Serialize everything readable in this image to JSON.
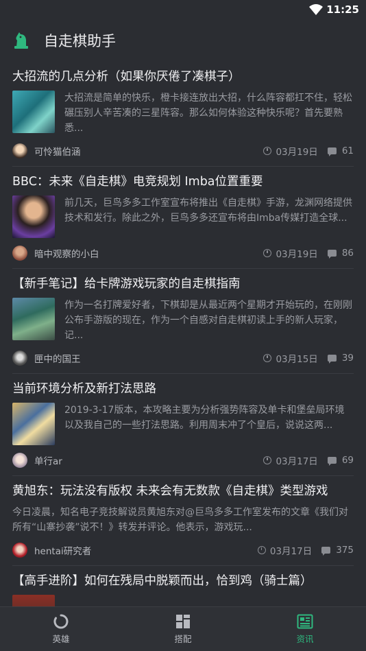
{
  "status": {
    "time": "11:25"
  },
  "app": {
    "title": "自走棋助手"
  },
  "articles": [
    {
      "title": "大招流的几点分析（如果你厌倦了凑棋子）",
      "summary": "大招流是简单的快乐，橙卡接连放出大招，什么阵容都扛不住，轻松碾压别人辛苦凑的三星阵容。那么如何体验这种快乐呢？首先要熟悉...",
      "author": "可怜猫伯涵",
      "date": "03月19日",
      "comments": "61"
    },
    {
      "title": "BBC：未来《自走棋》电竞规划 Imba位置重要",
      "summary": "前几天，巨鸟多多工作室宣布将推出《自走棋》手游，龙渊网络提供技术和发行。除此之外，巨鸟多多还宣布将由Imba传媒打造全球...",
      "author": "暗中观察的小白",
      "date": "03月19日",
      "comments": "86"
    },
    {
      "title": "【新手笔记】给卡牌游戏玩家的自走棋指南",
      "summary": "作为一名打牌爱好者，下棋却是从最近两个星期才开始玩的，在刚刚公布手游版的现在，作为一个自感对自走棋初读上手的新人玩家，记...",
      "author": "匣中的国王",
      "date": "03月15日",
      "comments": "39"
    },
    {
      "title": "当前环境分析及新打法思路",
      "summary": "2019-3-17版本，本攻略主要为分析强势阵容及单卡和堡垒局环境以及我自己的一些打法思路。利用周末冲了个皇后，说说这两...",
      "author": "单行ar",
      "date": "03月17日",
      "comments": "69"
    },
    {
      "title": "黄旭东：玩法没有版权 未来会有无数款《自走棋》类型游戏",
      "summary": "今日凌晨，知名电子竞技解说员黄旭东对@巨鸟多多工作室发布的文章《我们对所有“山寨抄袭”说不！》转发并评论。他表示，游戏玩...",
      "author": "hentai研究者",
      "date": "03月17日",
      "comments": "375"
    },
    {
      "title": "【高手进阶】如何在残局中脱颖而出，恰到鸡（骑士篇）"
    }
  ],
  "nav": {
    "items": [
      {
        "label": "英雄",
        "icon": "hero-ring-icon"
      },
      {
        "label": "搭配",
        "icon": "grid-layout-icon"
      },
      {
        "label": "资讯",
        "icon": "news-icon"
      }
    ],
    "active": "资讯"
  },
  "colors": {
    "accent": "#2fb87f",
    "background": "#2b2d32"
  }
}
